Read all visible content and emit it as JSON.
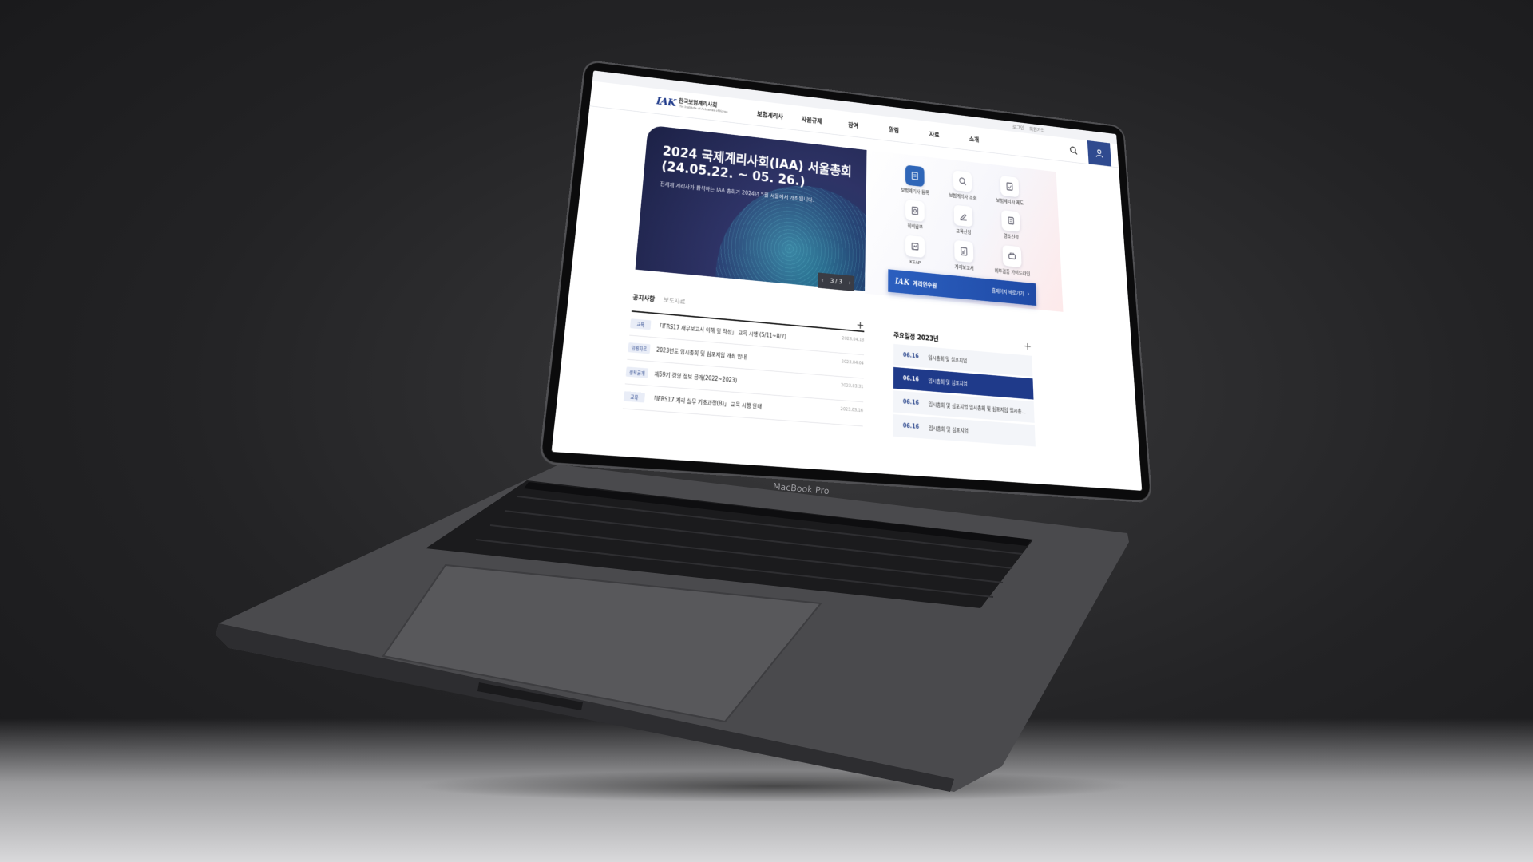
{
  "device": {
    "label": "MacBook Pro"
  },
  "topbar": {
    "login": "로그인",
    "signup": "회원가입"
  },
  "logo": {
    "mark": "IAK",
    "name_ko": "한국보험계리사회",
    "name_en": "The Institute of Actuaries of Korea"
  },
  "nav": {
    "items": [
      "보험계리사",
      "자율규제",
      "참여",
      "알림",
      "자료",
      "소개"
    ]
  },
  "hero": {
    "title": "2024 국제계리사회(IAA) 서울총회 (24.05.22. ~ 05. 26.)",
    "subtitle": "전세계 계리사가 참석하는 IAA 총회가 2024년 5월 서울에서 개최됩니다.",
    "pager": "3 / 3"
  },
  "quick_links": [
    {
      "label": "보험계리사 등록",
      "icon": "register-icon"
    },
    {
      "label": "보험계리사 조회",
      "icon": "search-doc-icon"
    },
    {
      "label": "보험계리사 제도",
      "icon": "policy-icon"
    },
    {
      "label": "회비납부",
      "icon": "payment-icon"
    },
    {
      "label": "교육신청",
      "icon": "education-icon"
    },
    {
      "label": "경조신청",
      "icon": "request-icon"
    },
    {
      "label": "KSAP",
      "icon": "ksap-icon"
    },
    {
      "label": "계리보고서",
      "icon": "report-icon"
    },
    {
      "label": "외부검증 가이드라인",
      "icon": "guide-icon"
    }
  ],
  "cta": {
    "logo": "IAK",
    "name": "계리연수원",
    "link": "홈페이지 바로가기"
  },
  "notices": {
    "tabs": [
      "공지사항",
      "보도자료"
    ],
    "items": [
      {
        "badge": "교육",
        "title": "「IFRS17 재무보고서 이해 및 작성」 교육 시행 (5/11~8/7)",
        "date": "2023.04.13"
      },
      {
        "badge": "임원자료",
        "title": "2023년도 임시총회 및 심포지엄 개최 안내",
        "date": "2023.04.04"
      },
      {
        "badge": "정보공개",
        "title": "제59기 경영 정보 공개(2022~2023)",
        "date": "2023.03.31"
      },
      {
        "badge": "교육",
        "title": "「IFRS17 계리 실무 기초과정(B)」 교육 시행 안내",
        "date": "2023.03.16"
      }
    ]
  },
  "schedule": {
    "title": "주요일정 2023년",
    "items": [
      {
        "date": "06.16",
        "text": "임시총회 및 심포지엄"
      },
      {
        "date": "06.16",
        "text": "임시총회 및 심포지엄"
      },
      {
        "date": "06.16",
        "text": "임시총회 및 심포지엄 임시총회 및 심포지엄 임시총..."
      },
      {
        "date": "06.16",
        "text": "임시총회 및 심포지엄"
      }
    ]
  }
}
